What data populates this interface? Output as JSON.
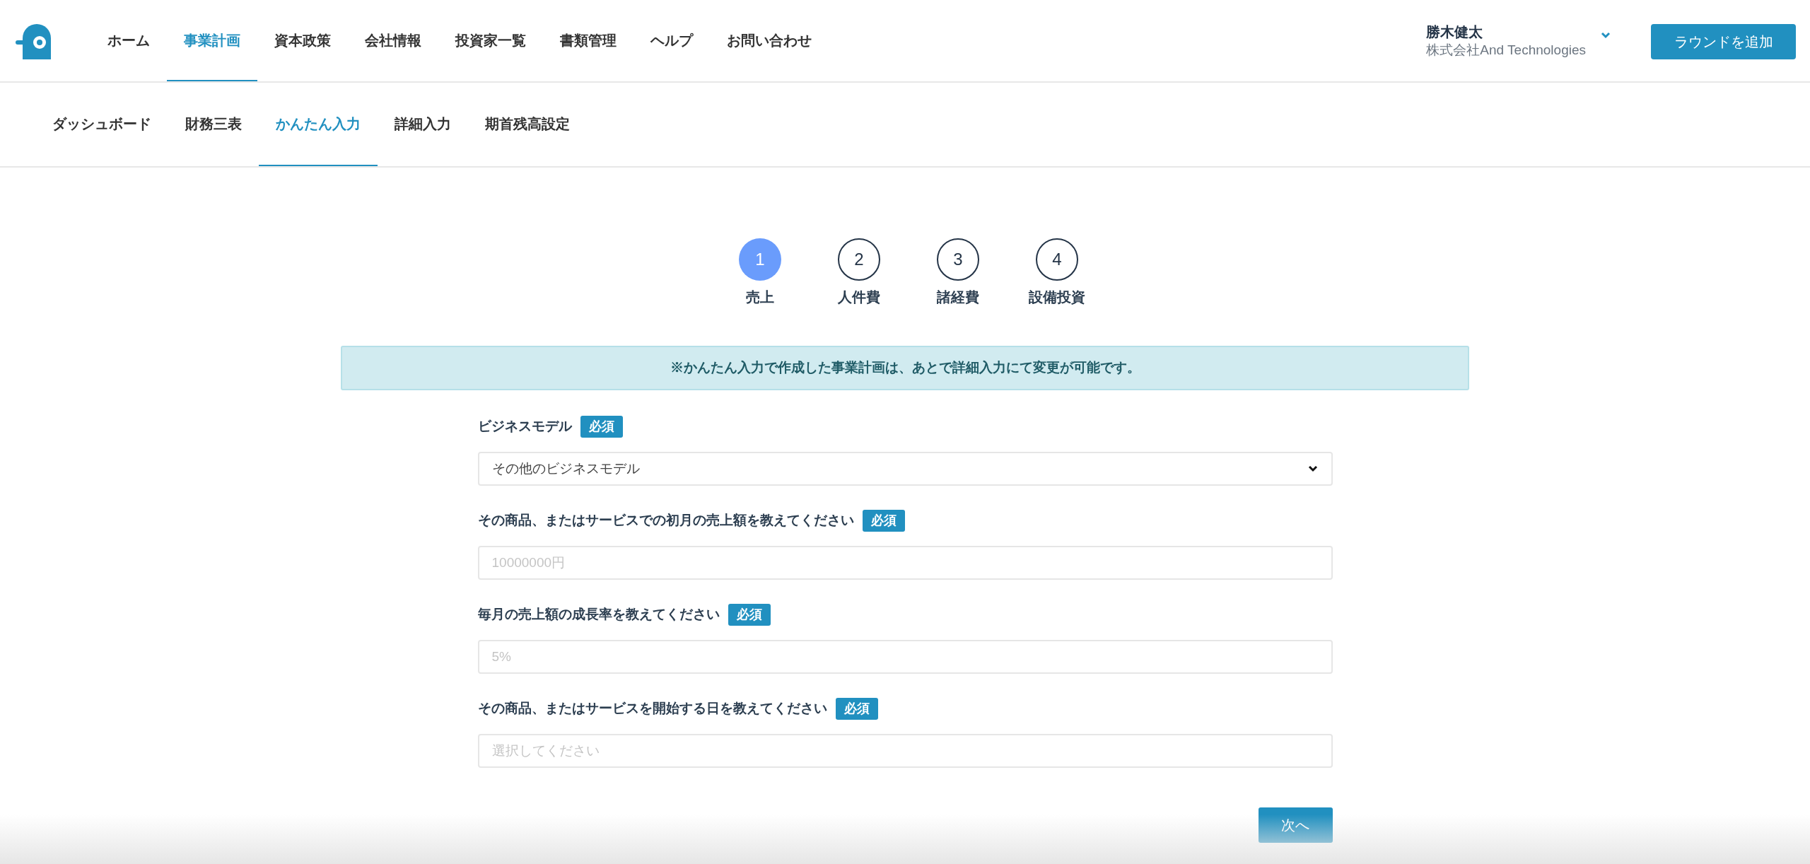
{
  "nav": [
    {
      "label": "ホーム",
      "selected": false
    },
    {
      "label": "事業計画",
      "selected": true
    },
    {
      "label": "資本政策",
      "selected": false
    },
    {
      "label": "会社情報",
      "selected": false
    },
    {
      "label": "投資家一覧",
      "selected": false
    },
    {
      "label": "書類管理",
      "selected": false
    },
    {
      "label": "ヘルプ",
      "selected": false
    },
    {
      "label": "お問い合わせ",
      "selected": false
    }
  ],
  "user": {
    "name": "勝木健太",
    "company": "株式会社And Technologies"
  },
  "add_round_button": "ラウンドを追加",
  "subnav": [
    {
      "label": "ダッシュボード",
      "selected": false
    },
    {
      "label": "財務三表",
      "selected": false
    },
    {
      "label": "かんたん入力",
      "selected": true
    },
    {
      "label": "詳細入力",
      "selected": false
    },
    {
      "label": "期首残高設定",
      "selected": false
    }
  ],
  "steps": [
    {
      "number": "1",
      "label": "売上",
      "selected": true
    },
    {
      "number": "2",
      "label": "人件費",
      "selected": false
    },
    {
      "number": "3",
      "label": "諸経費",
      "selected": false
    },
    {
      "number": "4",
      "label": "設備投資",
      "selected": false
    }
  ],
  "notice": "※かんたん入力で作成した事業計画は、あとで詳細入力にて変更が可能です。",
  "fields": [
    {
      "kind": "select",
      "label": "ビジネスモデル",
      "badge": "必須",
      "value": "その他のビジネスモデル"
    },
    {
      "kind": "input",
      "label": "その商品、またはサービスでの初月の売上額を教えてください",
      "badge": "必須",
      "placeholder": "10000000円"
    },
    {
      "kind": "input",
      "label": "毎月の売上額の成長率を教えてください",
      "badge": "必須",
      "placeholder": "5%"
    },
    {
      "kind": "input",
      "label": "その商品、またはサービスを開始する日を教えてください",
      "badge": "必須",
      "placeholder": "選択してください"
    }
  ],
  "next_button": "次へ"
}
